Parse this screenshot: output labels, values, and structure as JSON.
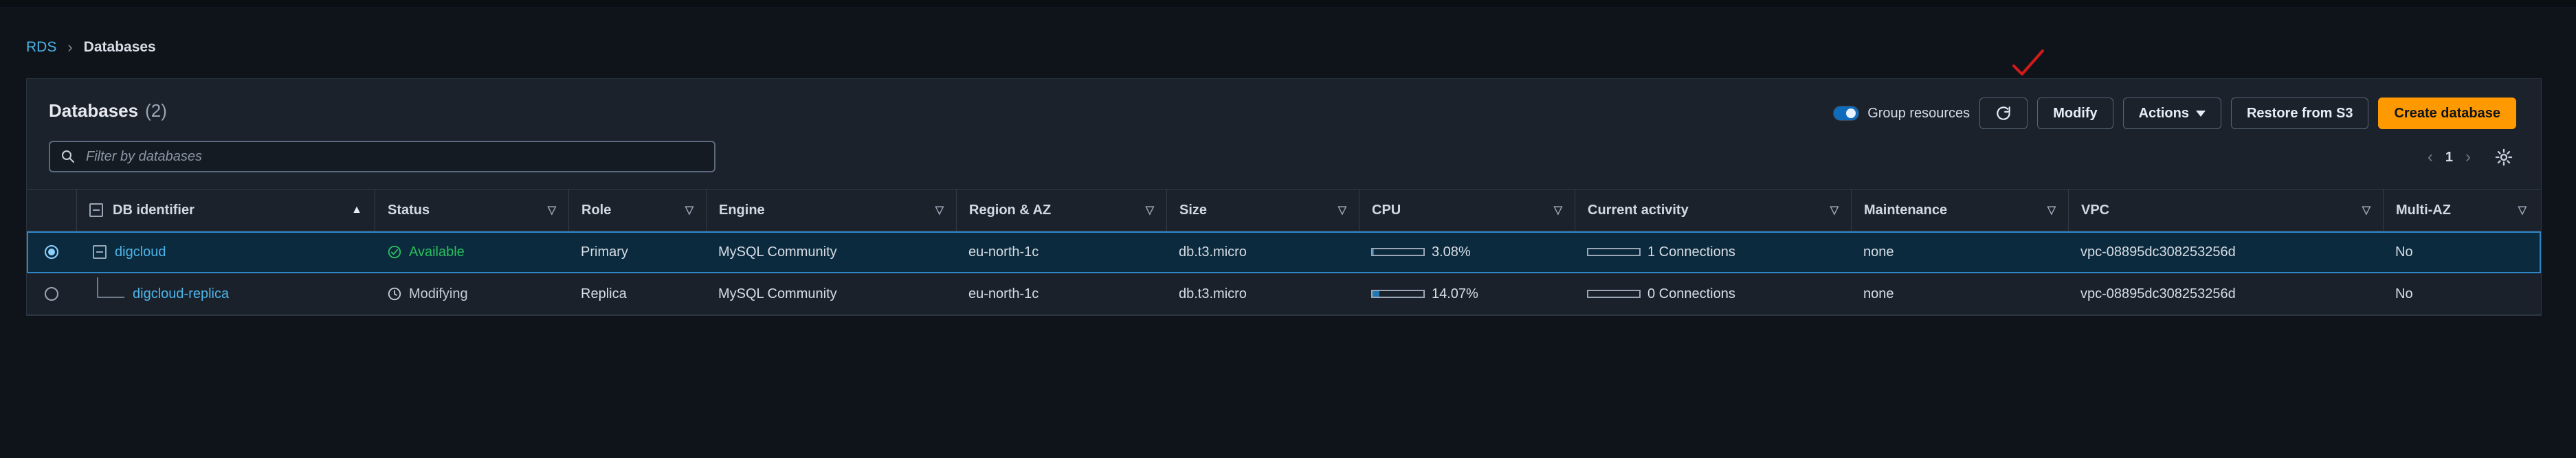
{
  "breadcrumb": {
    "root": "RDS",
    "current": "Databases"
  },
  "panel": {
    "title": "Databases",
    "count": "(2)"
  },
  "toolbar": {
    "group_resources_label": "Group resources",
    "group_resources_on": true,
    "refresh_icon": "refresh-icon",
    "modify_label": "Modify",
    "actions_label": "Actions",
    "restore_label": "Restore from S3",
    "create_label": "Create database"
  },
  "search": {
    "placeholder": "Filter by databases",
    "value": ""
  },
  "pagination": {
    "current_page": "1"
  },
  "table": {
    "columns": [
      {
        "label": "",
        "sort": "none"
      },
      {
        "label": "DB identifier",
        "sort": "asc"
      },
      {
        "label": "Status",
        "sort": "filter"
      },
      {
        "label": "Role",
        "sort": "filter"
      },
      {
        "label": "Engine",
        "sort": "filter"
      },
      {
        "label": "Region & AZ",
        "sort": "filter"
      },
      {
        "label": "Size",
        "sort": "filter"
      },
      {
        "label": "CPU",
        "sort": "filter"
      },
      {
        "label": "Current activity",
        "sort": "filter"
      },
      {
        "label": "Maintenance",
        "sort": "filter"
      },
      {
        "label": "VPC",
        "sort": "filter"
      },
      {
        "label": "Multi-AZ",
        "sort": "filter"
      }
    ],
    "rows": [
      {
        "selected": true,
        "db_identifier": "digcloud",
        "status": "Available",
        "role": "Primary",
        "engine": "MySQL Community",
        "region_az": "eu-north-1c",
        "size": "db.t3.micro",
        "cpu_percent": 3.08,
        "cpu_label": "3.08%",
        "activity_connections": 1,
        "activity_label": "1 Connections",
        "maintenance": "none",
        "vpc": "vpc-08895dc308253256d",
        "multi_az": "No"
      },
      {
        "selected": false,
        "db_identifier": "digcloud-replica",
        "status": "Modifying",
        "role": "Replica",
        "engine": "MySQL Community",
        "region_az": "eu-north-1c",
        "size": "db.t3.micro",
        "cpu_percent": 14.07,
        "cpu_label": "14.07%",
        "activity_connections": 0,
        "activity_label": "0 Connections",
        "maintenance": "none",
        "vpc": "vpc-08895dc308253256d",
        "multi_az": "No"
      }
    ]
  },
  "colors": {
    "accent_orange": "#ff9900",
    "link_blue": "#4db4e8",
    "success_green": "#29c05b",
    "selected_row_bg": "#0b2a3d",
    "selected_row_border": "#2f86c7",
    "annotation_red": "#d11b1b"
  },
  "icons": {
    "search": "search-icon",
    "settings": "gear-icon",
    "chevron_left": "chevron-left-icon",
    "chevron_right": "chevron-right-icon",
    "available": "check-circle-icon",
    "modifying": "clock-icon"
  }
}
